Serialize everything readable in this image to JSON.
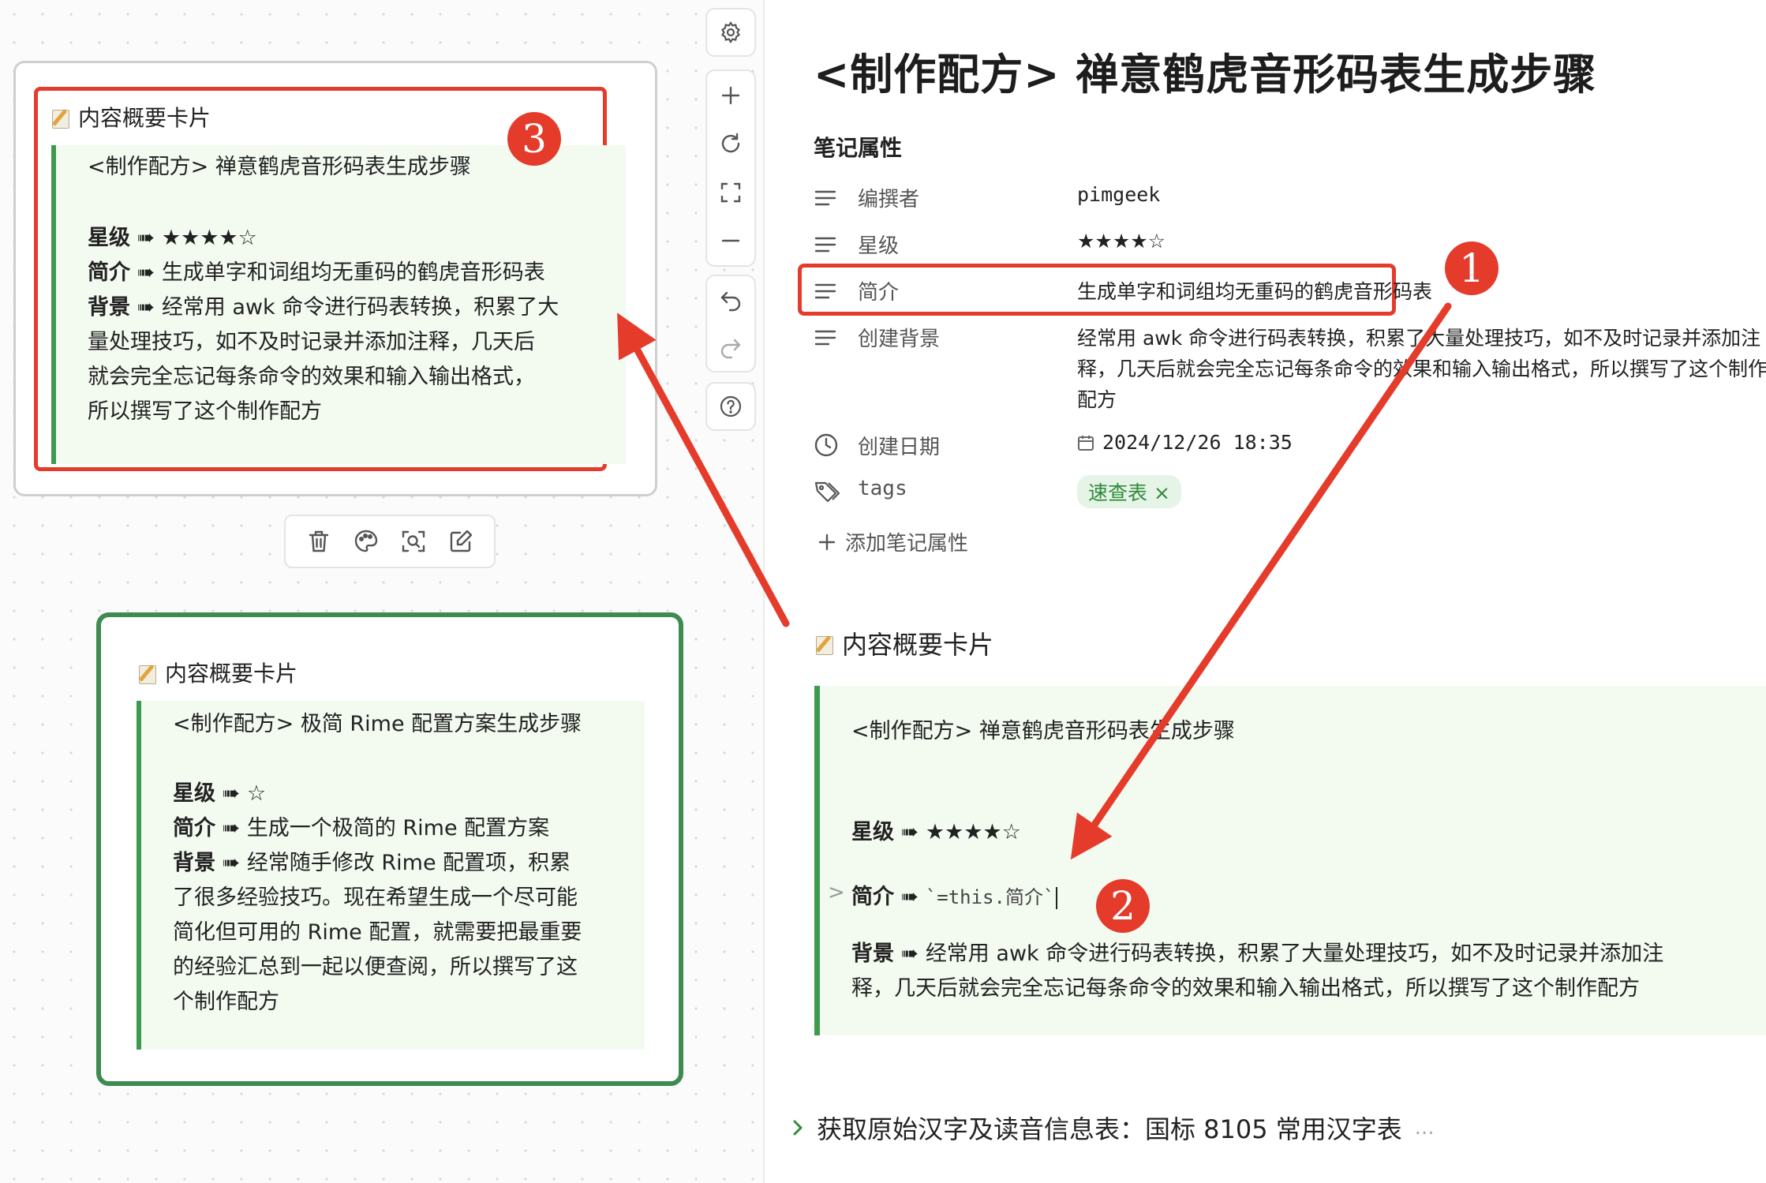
{
  "canvas": {
    "card1": {
      "heading": "内容概要卡片",
      "title": "<制作配方> 禅意鹤虎音形码表生成步骤",
      "rating_label": "星级",
      "rating_arrow": "➠",
      "rating_value": "★★★★☆",
      "intro_label": "简介",
      "intro_arrow": "➠",
      "intro_value": "生成单字和词组均无重码的鹤虎音形码表",
      "bg_label": "背景",
      "bg_arrow": "➠",
      "bg_line1": "经常用 awk 命令进行码表转换，积累了大",
      "bg_line2": "量处理技巧，如不及时记录并添加注释，几天后",
      "bg_line3": "就会完全忘记每条命令的效果和输入输出格式，",
      "bg_line4": "所以撰写了这个制作配方"
    },
    "card2": {
      "heading": "内容概要卡片",
      "title": "<制作配方> 极简 Rime 配置方案生成步骤",
      "rating_label": "星级",
      "rating_arrow": "➠",
      "rating_value": "☆",
      "intro_label": "简介",
      "intro_arrow": "➠",
      "intro_value": "生成一个极简的 Rime 配置方案",
      "bg_label": "背景",
      "bg_arrow": "➠",
      "bg_line1": "经常随手修改 Rime 配置项，积累",
      "bg_line2": "了很多经验技巧。现在希望生成一个尽可能",
      "bg_line3": "简化但可用的 Rime 配置，就需要把最重要",
      "bg_line4": "的经验汇总到一起以便查阅，所以撰写了这",
      "bg_line5": "个制作配方"
    },
    "card_toolbar": [
      "trash-icon",
      "palette-icon",
      "zoom-to-fit-icon",
      "edit-icon"
    ],
    "side_toolbar": [
      "settings-icon",
      "zoom-in-icon",
      "reset-icon",
      "fullscreen-icon",
      "zoom-out-icon",
      "undo-icon",
      "redo-icon",
      "help-icon"
    ]
  },
  "note": {
    "title": "<制作配方> 禅意鹤虎音形码表生成步骤",
    "properties_heading": "笔记属性",
    "properties": {
      "author": {
        "key": "编撰者",
        "value": "pimgeek"
      },
      "rating": {
        "key": "星级",
        "value": "★★★★☆"
      },
      "intro": {
        "key": "简介",
        "value": "生成单字和词组均无重码的鹤虎音形码表"
      },
      "background": {
        "key": "创建背景",
        "line1": "经常用 awk 命令进行码表转换，积累了大量处理技巧，如不及时记录并添加注",
        "line2": "释，几天后就会完全忘记每条命令的效果和输入输出格式，所以撰写了这个制作",
        "line3": "配方"
      },
      "created": {
        "key": "创建日期",
        "value": "2024/12/26  18:35"
      },
      "tags": {
        "key": "tags",
        "value": "速查表",
        "remove": "×"
      }
    },
    "add_property": "添加笔记属性",
    "summary_heading": "内容概要卡片",
    "callout": {
      "title": "<制作配方> 禅意鹤虎音形码表生成步骤",
      "rating_label": "星级",
      "rating_arrow": "➠",
      "rating_value": "★★★★☆",
      "fold_marker": ">",
      "intro_label": "简介",
      "intro_arrow": "➠",
      "intro_code": "`=this.简介`",
      "bg_label": "背景",
      "bg_arrow": "➠",
      "bg_line1": "经常用 awk 命令进行码表转换，积累了大量处理技巧，如不及时记录并添加注",
      "bg_line2": "释，几天后就会完全忘记每条命令的效果和输入输出格式，所以撰写了这个制作配方"
    },
    "next_section": "获取原始汉字及读音信息表：国标 8105 常用汉字表",
    "next_section_ellipsis": "..."
  },
  "annotations": {
    "one": "1",
    "two": "2",
    "three": "3"
  },
  "colors": {
    "annotation_red": "#e53b2b",
    "callout_green": "#3e9a4f",
    "card_border_green": "#3e8b4f"
  }
}
